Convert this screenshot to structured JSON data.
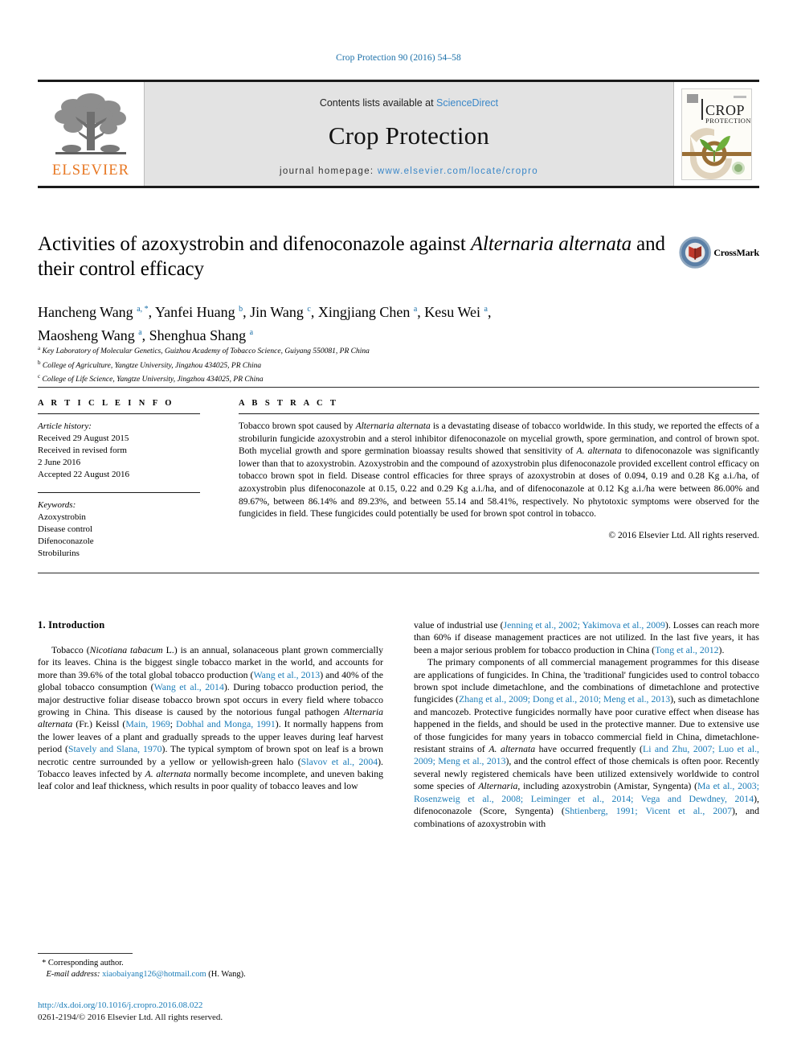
{
  "running_head": "Crop Protection 90 (2016) 54–58",
  "masthead": {
    "publisher_logo_name": "elsevier-tree-logo",
    "publisher_wordmark": "ELSEVIER",
    "contents_prefix": "Contents lists available at ",
    "contents_link": "ScienceDirect",
    "journal_title": "Crop Protection",
    "homepage_prefix": "journal homepage: ",
    "homepage_url": "www.elsevier.com/locate/cropro",
    "cover_title_main": "CROP",
    "cover_title_sub": "PROTECTION",
    "link_color": "#3a87c8"
  },
  "article": {
    "title_part1": "Activities of azoxystrobin and difenoconazole against ",
    "title_italic1": "Alternaria alternata",
    "title_part2": " and their control efficacy",
    "crossmark_label": "CrossMark",
    "authors": [
      {
        "name": "Hancheng Wang",
        "marks": "a, *"
      },
      {
        "name": "Yanfei Huang",
        "marks": "b"
      },
      {
        "name": "Jin Wang",
        "marks": "c"
      },
      {
        "name": "Xingjiang Chen",
        "marks": "a"
      },
      {
        "name": "Kesu Wei",
        "marks": "a"
      },
      {
        "name": "Maosheng Wang",
        "marks": "a"
      },
      {
        "name": "Shenghua Shang",
        "marks": "a"
      }
    ],
    "affiliations": [
      {
        "mark": "a",
        "text": "Key Laboratory of Molecular Genetics, Guizhou Academy of Tobacco Science, Guiyang 550081, PR China"
      },
      {
        "mark": "b",
        "text": "College of Agriculture, Yangtze University, Jingzhou 434025, PR China"
      },
      {
        "mark": "c",
        "text": "College of Life Science, Yangtze University, Jingzhou 434025, PR China"
      }
    ]
  },
  "article_info": {
    "heading": "A R T I C L E  I N F O",
    "history_label": "Article history:",
    "history_lines": [
      "Received 29 August 2015",
      "Received in revised form",
      "2 June 2016",
      "Accepted 22 August 2016"
    ],
    "keywords_label": "Keywords:",
    "keywords": [
      "Azoxystrobin",
      "Disease control",
      "Difenoconazole",
      "Strobilurins"
    ]
  },
  "abstract": {
    "heading": "A B S T R A C T",
    "p1_a": "Tobacco brown spot caused by ",
    "p1_i1": "Alternaria alternata",
    "p1_b": " is a devastating disease of tobacco worldwide. In this study, we reported the effects of a strobilurin fungicide azoxystrobin and a sterol inhibitor difenoconazole on mycelial growth, spore germination, and control of brown spot. Both mycelial growth and spore germination bioassay results showed that sensitivity of ",
    "p1_i2": "A. alternata",
    "p1_c": " to difenoconazole was significantly lower than that to azoxystrobin. Azoxystrobin and the compound of azoxystrobin plus difenoconazole provided excellent control efficacy on tobacco brown spot in field. Disease control efficacies for three sprays of azoxystrobin at doses of 0.094, 0.19 and 0.28 Kg a.i./ha, of azoxystrobin plus difenoconazole at 0.15, 0.22 and 0.29 Kg a.i./ha, and of difenoconazole at 0.12 Kg a.i./ha were between 86.00% and 89.67%, between 86.14% and 89.23%, and between 55.14 and 58.41%, respectively. No phytotoxic symptoms were observed for the fungicides in field. These fungicides could potentially be used for brown spot control in tobacco.",
    "copyright": "© 2016 Elsevier Ltd. All rights reserved."
  },
  "body": {
    "section_heading": "1. Introduction",
    "left_p1_a": "Tobacco (",
    "left_p1_i1": "Nicotiana tabacum",
    "left_p1_b": " L.) is an annual, solanaceous plant grown commercially for its leaves. China is the biggest single tobacco market in the world, and accounts for more than 39.6% of the total global tobacco production (",
    "left_p1_r1": "Wang et al., 2013",
    "left_p1_c": ") and 40% of the global tobacco consumption (",
    "left_p1_r2": "Wang et al., 2014",
    "left_p1_d": "). During tobacco production period, the major destructive foliar disease tobacco brown spot occurs in every field where tobacco growing in China. This disease is caused by the notorious fungal pathogen ",
    "left_p1_i2": "Alternaria alternata",
    "left_p1_e": " (Fr.) Keissl (",
    "left_p1_r3": "Main, 1969",
    "left_p1_f": "; ",
    "left_p1_r4": "Dobhal and Monga, 1991",
    "left_p1_g": "). It normally happens from the lower leaves of a plant and gradually spreads to the upper leaves during leaf harvest period (",
    "left_p1_r5": "Stavely and Slana, 1970",
    "left_p1_h": "). The typical symptom of brown spot on leaf is a brown necrotic centre surrounded by a yellow or yellowish-green halo (",
    "left_p1_r6": "Slavov et al., 2004",
    "left_p1_i": "). Tobacco leaves infected by ",
    "left_p1_i3": "A. alternata",
    "left_p1_j": " normally become incomplete, and uneven baking leaf color and leaf thickness, which results in poor quality of tobacco leaves and low",
    "right_p1_a": "value of industrial use (",
    "right_p1_r1": "Jenning et al., 2002; Yakimova et al., 2009",
    "right_p1_b": "). Losses can reach more than 60% if disease management practices are not utilized. In the last five years, it has been a major serious problem for tobacco production in China (",
    "right_p1_r2": "Tong et al., 2012",
    "right_p1_c": ").",
    "right_p2_a": "The primary components of all commercial management programmes for this disease are applications of fungicides. In China, the 'traditional' fungicides used to control tobacco brown spot include dimetachlone, and the combinations of dimetachlone and protective fungicides (",
    "right_p2_r1": "Zhang et al., 2009; Dong et al., 2010; Meng et al., 2013",
    "right_p2_b": "), such as dimetachlone and mancozeb. Protective fungicides normally have poor curative effect when disease has happened in the fields, and should be used in the protective manner. Due to extensive use of those fungicides for many years in tobacco commercial field in China, dimetachlone-resistant strains of ",
    "right_p2_i1": "A. alternata",
    "right_p2_c": " have occurred frequently (",
    "right_p2_r2": "Li and Zhu, 2007; Luo et al., 2009; Meng et al., 2013",
    "right_p2_d": "), and the control effect of those chemicals is often poor. Recently several newly registered chemicals have been utilized extensively worldwide to control some species of ",
    "right_p2_i2": "Alternaria",
    "right_p2_e": ", including azoxystrobin (Amistar, Syngenta) (",
    "right_p2_r3": "Ma et al., 2003; Rosenzweig et al., 2008; Leiminger et al., 2014; Vega and Dewdney, 2014",
    "right_p2_f": "), difenoconazole (Score, Syngenta) (",
    "right_p2_r4": "Shtienberg, 1991; Vicent et al., 2007",
    "right_p2_g": "), and combinations of azoxystrobin with"
  },
  "footer": {
    "corresponding_star": "*",
    "corresponding_label": "Corresponding author.",
    "email_label": "E-mail address:",
    "email": "xiaobaiyang126@hotmail.com",
    "email_suffix": "(H. Wang).",
    "doi": "http://dx.doi.org/10.1016/j.cropro.2016.08.022",
    "issn_line": "0261-2194/© 2016 Elsevier Ltd. All rights reserved."
  }
}
